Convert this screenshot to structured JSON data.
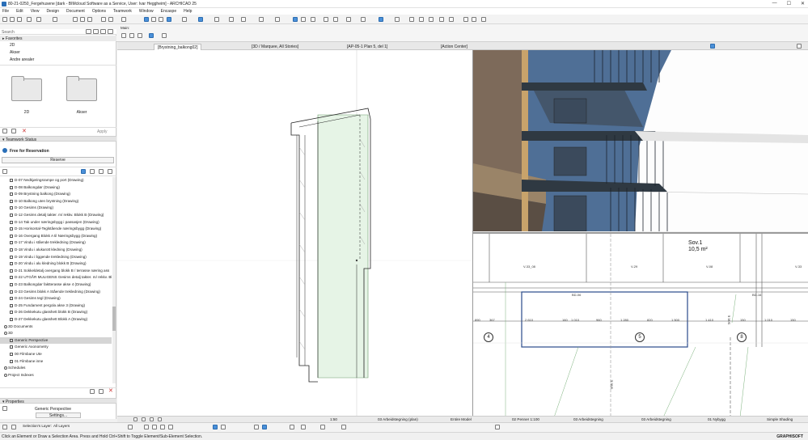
{
  "window": {
    "title": "80-21-0250_Fergehusene [dark - BIMcloud Software as a Service, User: Ivar Heggheim] - ARCHICAD 25",
    "controls": [
      "—",
      "☐",
      "✕"
    ]
  },
  "menu": [
    "File",
    "Edit",
    "View",
    "Design",
    "Document",
    "Options",
    "Teamwork",
    "Window",
    "Encaspe",
    "Help"
  ],
  "toolbox_label": "Main:",
  "navigator": {
    "search_placeholder": "Search",
    "favorites_header": "Favorites",
    "favorites": [
      "2D",
      "Akser",
      "Andre arealer"
    ],
    "folders": [
      {
        "label": "2D"
      },
      {
        "label": "Akser"
      }
    ],
    "apply_label": "Apply"
  },
  "teamwork": {
    "header": "Teamwork Status",
    "status": "Free for Reservation",
    "reserve_label": "Reserve"
  },
  "tree": {
    "items": [
      {
        "label": "D-07 Nedkjøringsrampe og port (Drawing)",
        "level": 2
      },
      {
        "label": "D-08 Balkongdør (Drawing)",
        "level": 2
      },
      {
        "label": "D-09 Brystning balkong (Drawing)",
        "level": 2
      },
      {
        "label": "D-10 Balkong uten brystning (Drawing)",
        "level": 2
      },
      {
        "label": "D-10 Gesims (Drawing)",
        "level": 2
      },
      {
        "label": "D-12 Gesims detalj takter. m/ rekkv. Blokk B (Drawing)",
        "level": 2
      },
      {
        "label": "D-14 Tak under næringsbygg i passasjen (Drawing)",
        "level": 2
      },
      {
        "label": "D-15 Horisontal-Teglstående næringsbygg (Drawing)",
        "level": 2
      },
      {
        "label": "D-16 Overgang Blokk A til Næringsbygg (Drawing)",
        "level": 2
      },
      {
        "label": "D-17 Vindu i stående trekledning (Drawing)",
        "level": 2
      },
      {
        "label": "D-18 Vindu i alukarott kledning (Drawing)",
        "level": 2
      },
      {
        "label": "D-19 Vindu i liggende trekledning (Drawing)",
        "level": 2
      },
      {
        "label": "D-20 Vindu i alu kledning blokk B (Drawing)",
        "level": 2
      },
      {
        "label": "D-21 Sokkeldetalj overgang blokk B / terrasse næring ass",
        "level": 2
      },
      {
        "label": "D-22 UTGÅR MULIGENS Gesims detalj takter. m/ rekkv. Bl",
        "level": 2
      },
      {
        "label": "D-23 Balkongdør faktterasse akse 4 (Drawing)",
        "level": 2
      },
      {
        "label": "D-23 Gesims blokk A Stående trekledning (Drawing)",
        "level": 2
      },
      {
        "label": "D-24 Gesims tegl (Drawing)",
        "level": 2
      },
      {
        "label": "D-25 Fundament pergola akse 3 (Drawing)",
        "level": 2
      },
      {
        "label": "D-26 Dekkekutu glasshett blokk B (Drawing)",
        "level": 2
      },
      {
        "label": "D-27 Dekkekutu glasshett Blokk A (Drawing)",
        "level": 2
      },
      {
        "label": "3D Documents",
        "level": 1
      },
      {
        "label": "3D",
        "level": 1
      },
      {
        "label": "Generic Perspective",
        "level": 2,
        "selected": true
      },
      {
        "label": "Generic Axonometry",
        "level": 2
      },
      {
        "label": "00 Filmbane Ute",
        "level": 2
      },
      {
        "label": "01 Filmbane inne",
        "level": 2
      },
      {
        "label": "Schedules",
        "level": 1
      },
      {
        "label": "Project Indexes",
        "level": 1
      }
    ]
  },
  "properties": {
    "header": "Properties",
    "value": "Generic Perspective",
    "settings_label": "Settings..."
  },
  "tabs": [
    "[Brystning_balkong02]",
    "[3D / Marquee, All Stories]",
    "[AP-05-1 Plan 5, del 1]",
    "[Action Center]"
  ],
  "plan": {
    "room_name": "Sov.1",
    "room_area": "10,5 m²",
    "axis_labels": [
      "4",
      "5",
      "8"
    ],
    "dims": [
      "890",
      "367",
      "2 610",
      "160",
      "1 010",
      "960",
      "1 280",
      "820",
      "1 500",
      "1 410",
      "150",
      "1 010",
      "150"
    ],
    "tags": [
      "V-33_08",
      "V-29",
      "V-08",
      "V-33",
      "BD-06",
      "BD-16"
    ],
    "section": "Snitt E"
  },
  "viewbar": {
    "zoom_a": "1:50",
    "layer": "03 Arbeidstegning (plan)",
    "model": "Entire Model",
    "pen": "02 Penner 1:100",
    "mvo1": "03 Arbeidstegning",
    "mvo2": "03 Arbeidstegning",
    "renovation": "01 Nybygg",
    "shading": "Simple Shading"
  },
  "bottom": {
    "layer_label": "Selection's Layer:",
    "layer_value": "All Layers"
  },
  "status": {
    "text": "Click an Element or Draw a Selection Area. Press and Hold Ctrl+Shift to Toggle Element/Sub-Element Selection.",
    "brand": "GRAPHISOFT"
  },
  "colors": {
    "accent": "#2a6fb8",
    "facade": "#4f6f96",
    "green_fill": "#e6f4e6"
  }
}
